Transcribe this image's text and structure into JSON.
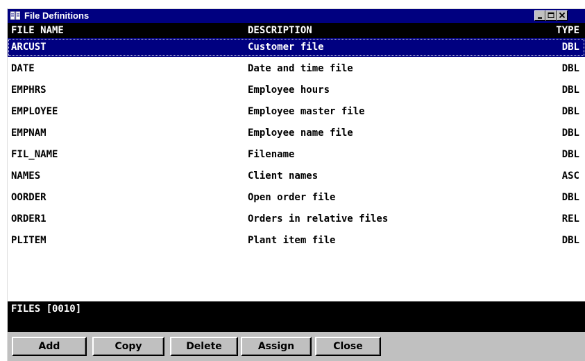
{
  "window": {
    "title": "File Definitions",
    "colors": {
      "title_bar": "#000080",
      "selection": "#000080",
      "header_bg": "#000000",
      "header_text": "#ffffff",
      "chrome": "#c0c0c0"
    }
  },
  "table": {
    "columns": {
      "name": "FILE NAME",
      "description": "DESCRIPTION",
      "type": "TYPE"
    },
    "rows": [
      {
        "name": "ARCUST",
        "description": "Customer file",
        "type": "DBL",
        "selected": true
      },
      {
        "name": "DATE",
        "description": "Date and time file",
        "type": "DBL"
      },
      {
        "name": "EMPHRS",
        "description": "Employee hours",
        "type": "DBL"
      },
      {
        "name": "EMPLOYEE",
        "description": "Employee master file",
        "type": "DBL"
      },
      {
        "name": "EMPNAM",
        "description": "Employee name file",
        "type": "DBL"
      },
      {
        "name": "FIL_NAME",
        "description": "Filename",
        "type": "DBL"
      },
      {
        "name": "NAMES",
        "description": "Client names",
        "type": "ASC"
      },
      {
        "name": "OORDER",
        "description": "Open order file",
        "type": "DBL"
      },
      {
        "name": "ORDER1",
        "description": "Orders in relative files",
        "type": "REL"
      },
      {
        "name": "PLITEM",
        "description": "Plant item file",
        "type": "DBL"
      }
    ]
  },
  "status": {
    "files_count": "FILES [0010]"
  },
  "buttons": {
    "add": "Add",
    "copy": "Copy",
    "delete": "Delete",
    "assign": "Assign",
    "close": "Close"
  }
}
